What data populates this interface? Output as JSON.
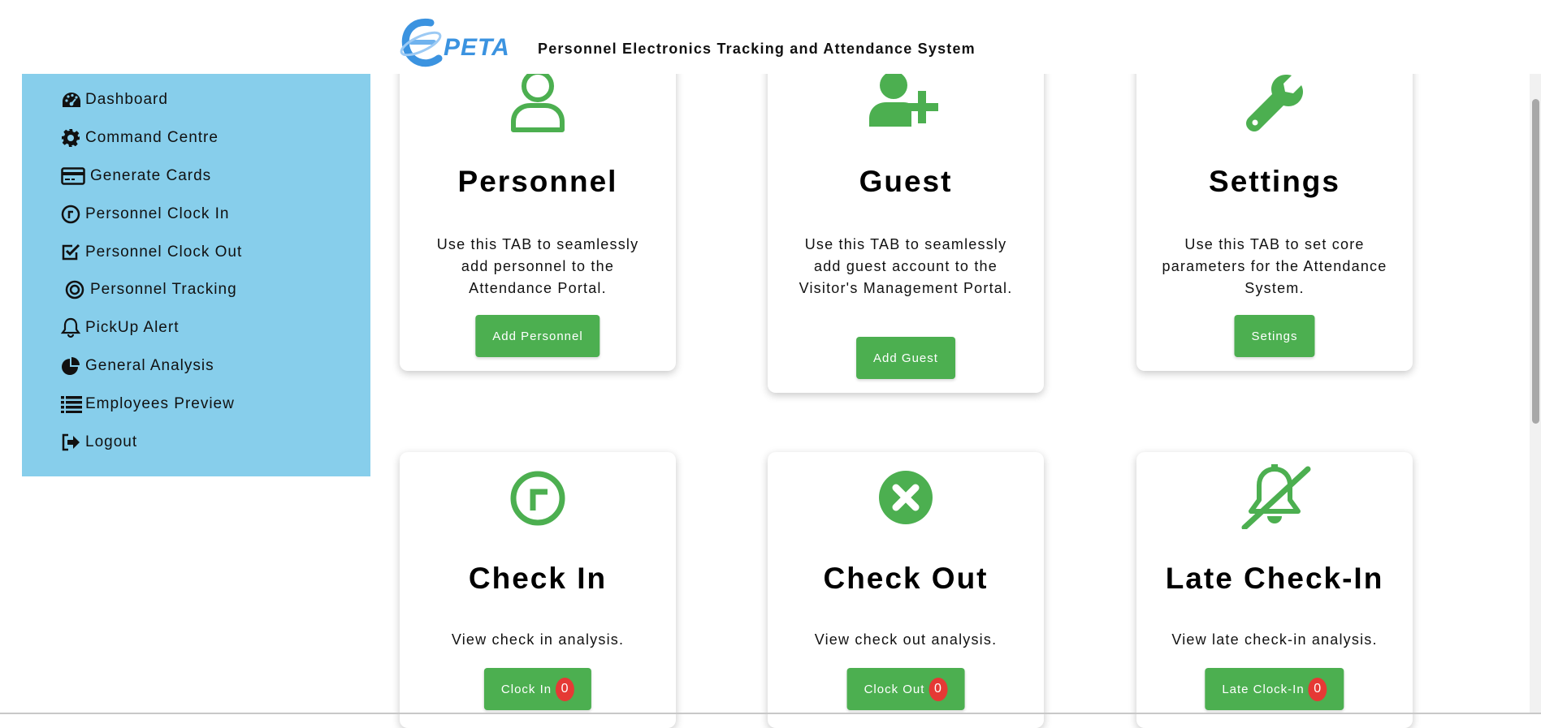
{
  "header": {
    "logo_text": "PETA",
    "title": "Personnel Electronics Tracking and Attendance System"
  },
  "sidebar": {
    "items": [
      {
        "label": "Dashboard",
        "icon": "dashboard-gauge-icon"
      },
      {
        "label": "Command Centre",
        "icon": "gear-icon"
      },
      {
        "label": "Generate Cards",
        "icon": "credit-card-icon"
      },
      {
        "label": "Personnel Clock In",
        "icon": "clock-icon"
      },
      {
        "label": "Personnel Clock Out",
        "icon": "checkbox-icon"
      },
      {
        "label": "Personnel Tracking",
        "icon": "target-icon"
      },
      {
        "label": "PickUp Alert",
        "icon": "bell-icon"
      },
      {
        "label": "General Analysis",
        "icon": "pie-chart-icon"
      },
      {
        "label": "Employees Preview",
        "icon": "list-icon"
      },
      {
        "label": "Logout",
        "icon": "sign-out-icon"
      }
    ]
  },
  "cards": {
    "personnel": {
      "title": "Personnel",
      "description": "Use this TAB to seamlessly add personnel to the Attendance Portal.",
      "button": "Add Personnel",
      "icon": "user-icon"
    },
    "guest": {
      "title": "Guest",
      "description": "Use this TAB to seamlessly add guest account to the Visitor's Management Portal.",
      "button": "Add Guest",
      "icon": "user-plus-icon"
    },
    "settings": {
      "title": "Settings",
      "description": "Use this TAB to set core parameters for the Attendance System.",
      "button": "Setings",
      "icon": "wrench-icon"
    },
    "checkin": {
      "title": "Check In",
      "description": "View check in analysis.",
      "button": "Clock In",
      "count": "0",
      "icon": "clock-circle-icon"
    },
    "checkout": {
      "title": "Check Out",
      "description": "View check out analysis.",
      "button": "Clock Out",
      "count": "0",
      "icon": "x-circle-icon"
    },
    "late": {
      "title": "Late Check-In",
      "description": "View late check-in analysis.",
      "button": "Late Clock-In",
      "count": "0",
      "icon": "bell-slash-icon"
    }
  },
  "colors": {
    "sidebar_bg": "#87ceeb",
    "accent_green": "#4caf50",
    "badge_red": "#e53935",
    "logo_blue": "#3b93e0"
  }
}
